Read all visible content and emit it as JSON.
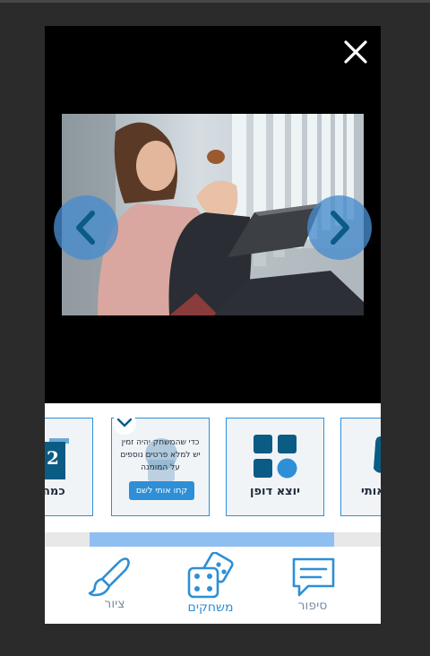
{
  "viewer": {
    "close_icon": "close-icon",
    "prev_icon": "chevron-left-icon",
    "next_icon": "chevron-right-icon"
  },
  "cards": {
    "left_partial": {
      "digit": "2",
      "label": "כמה"
    },
    "locked": {
      "text": "כדי שהמשחק יהיה זמין יש למלא פרטים נוספים על המומנה",
      "button": "קחו אותי לשם"
    },
    "dafon": {
      "label": "יוצא דופן"
    },
    "right_partial": {
      "label": "אותי"
    }
  },
  "scroll": {
    "thumb_fraction": 0.73
  },
  "tabs": [
    {
      "label": "ציור",
      "icon": "paintbrush-icon"
    },
    {
      "label": "משחקים",
      "icon": "dice-icon"
    },
    {
      "label": "סיפור",
      "icon": "chat-bubble-icon"
    }
  ],
  "colors": {
    "accent": "#2e8fd6",
    "nav_button": "#468ccd",
    "scroll_thumb": "#8fbff0",
    "icon_dark": "#0a5c84"
  }
}
